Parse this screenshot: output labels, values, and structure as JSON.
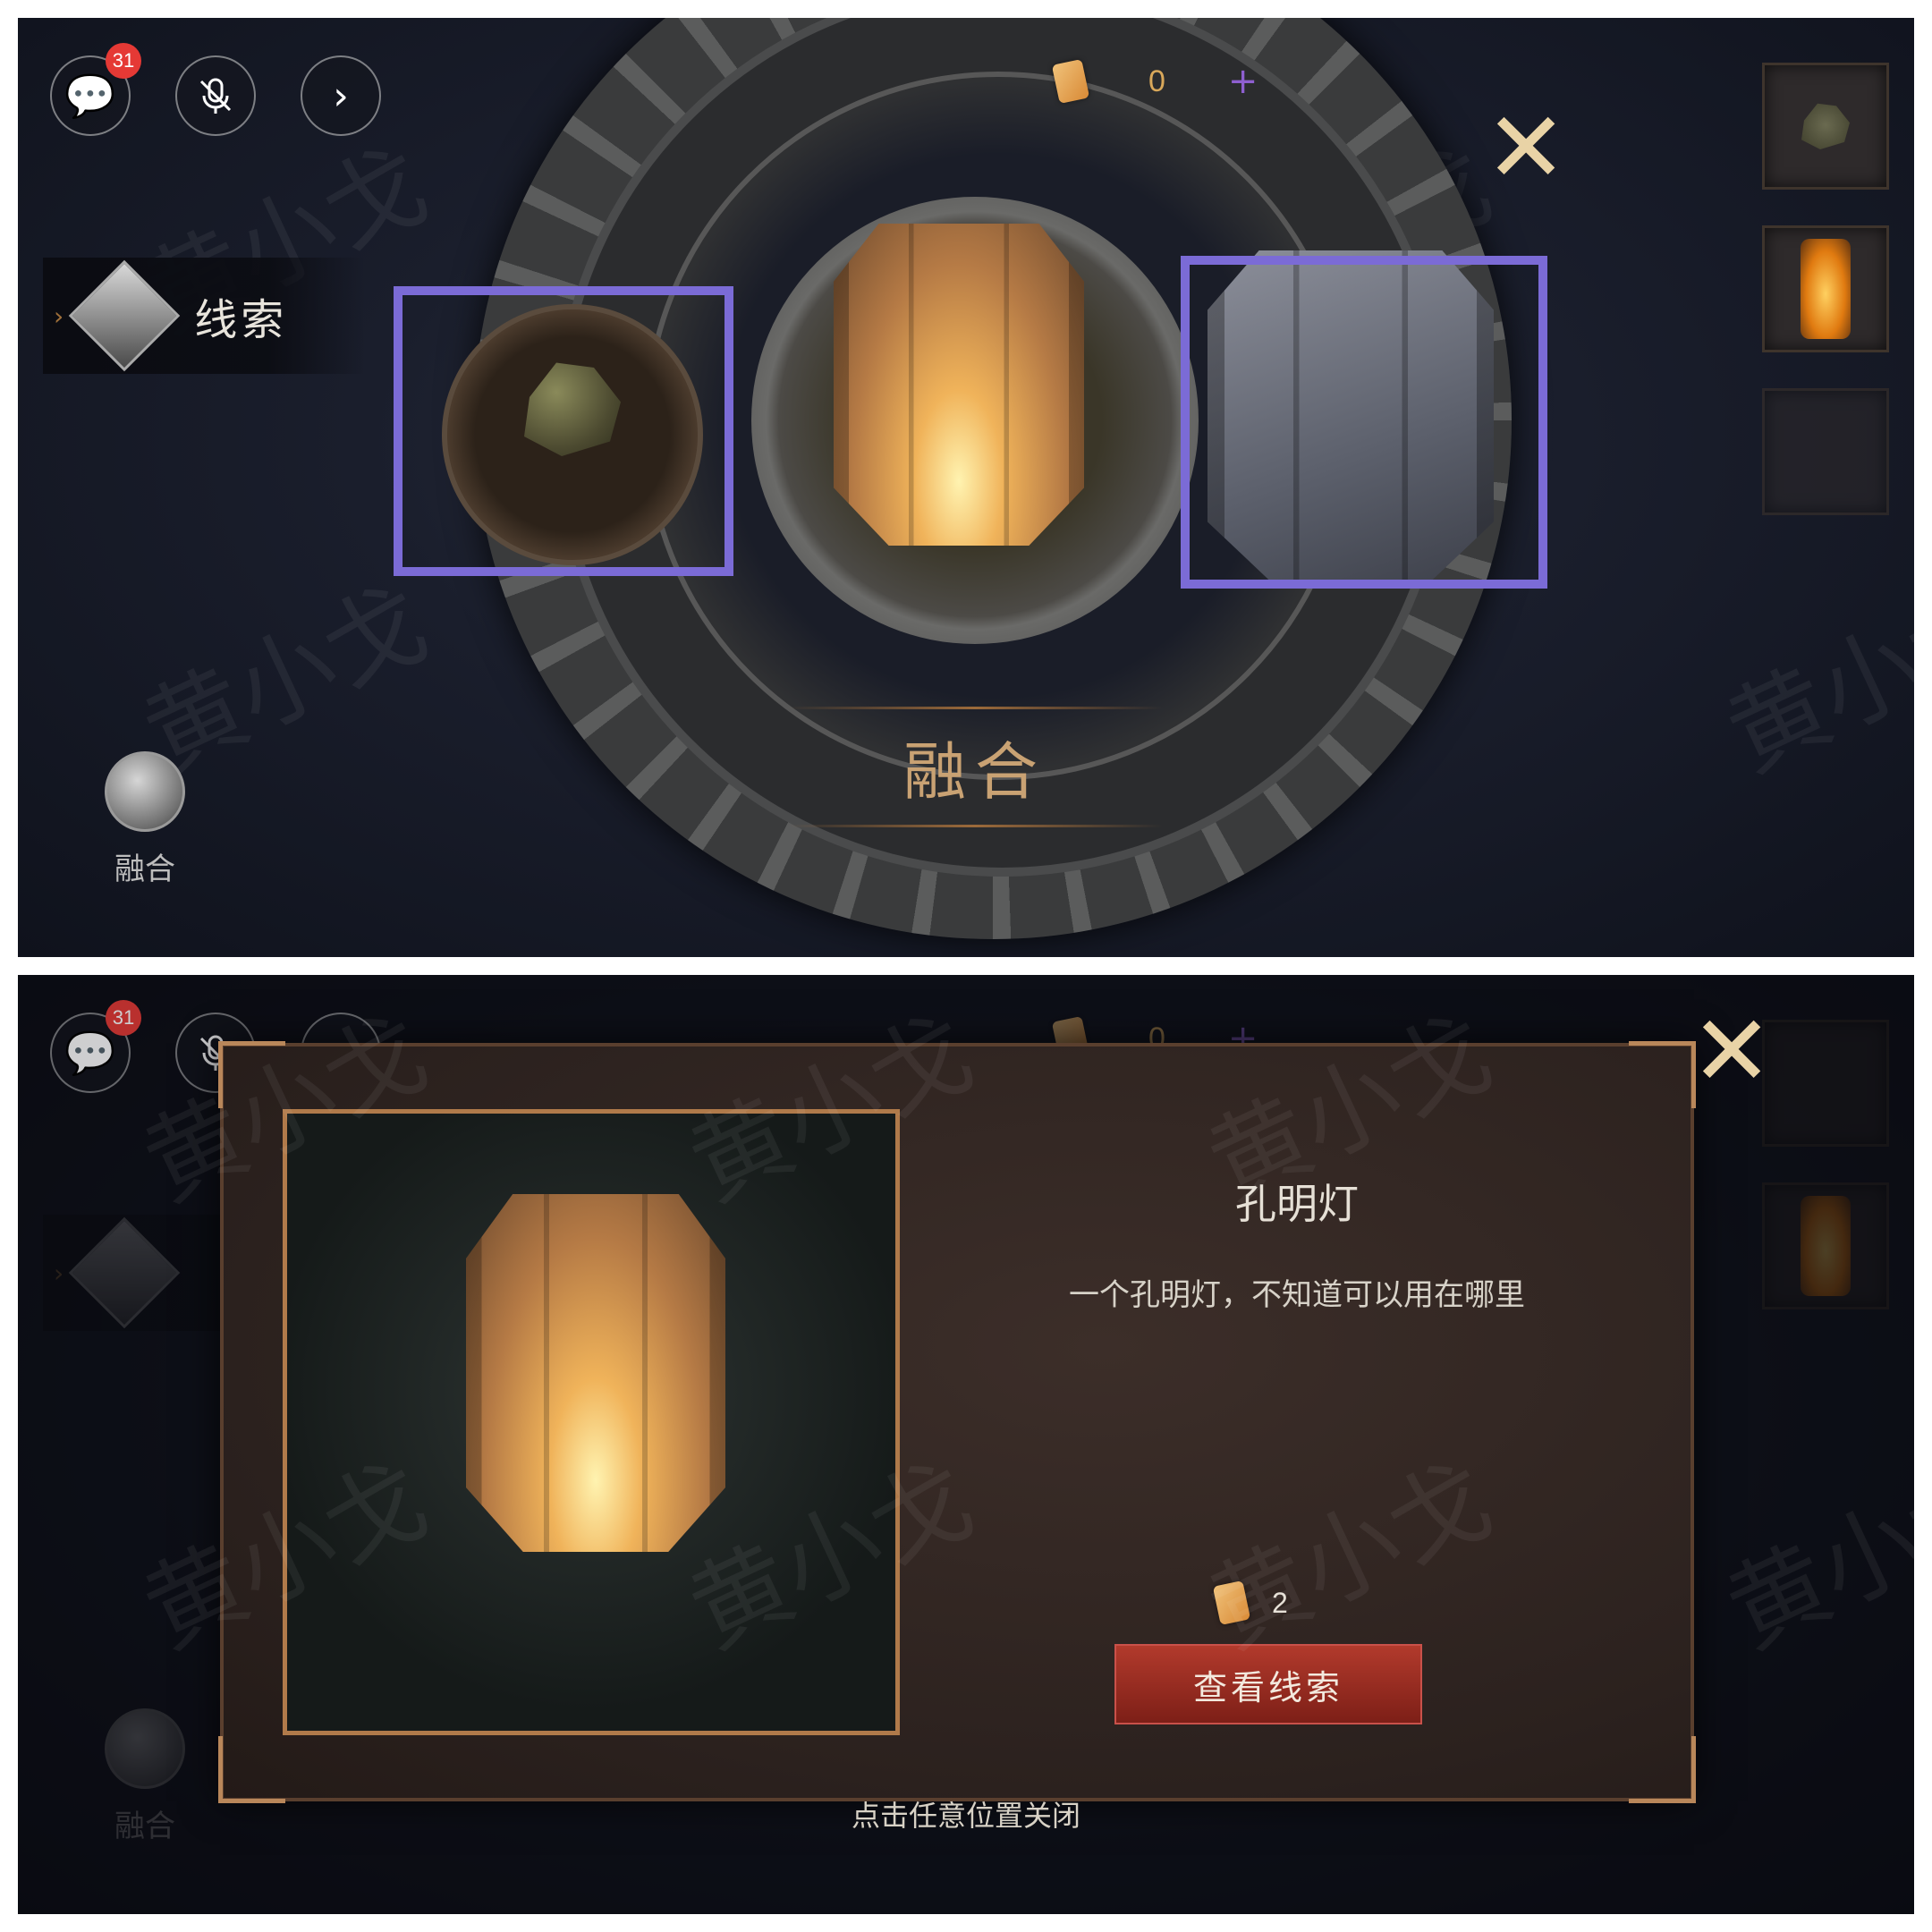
{
  "hud": {
    "chat_badge": "31",
    "currency_value": "0",
    "currency_plus": "+"
  },
  "watermark": "黄小戈",
  "top_screen": {
    "clue_tab_label": "线索",
    "fuse_button_label": "融合",
    "fuse_title": "融合",
    "highlight_color": "#7b6bd6"
  },
  "bottom_screen": {
    "clue_tab_label": "",
    "fuse_button_label": "融合",
    "item_name": "孔明灯",
    "item_description": "一个孔明灯，不知道可以用在哪里",
    "cost_value": "2",
    "view_clue_button": "查看线索",
    "close_hint": "点击任意位置关闭"
  },
  "colors": {
    "accent_red": "#b23a2c",
    "frame_gold": "#b07a4a",
    "badge_red": "#e53935"
  }
}
